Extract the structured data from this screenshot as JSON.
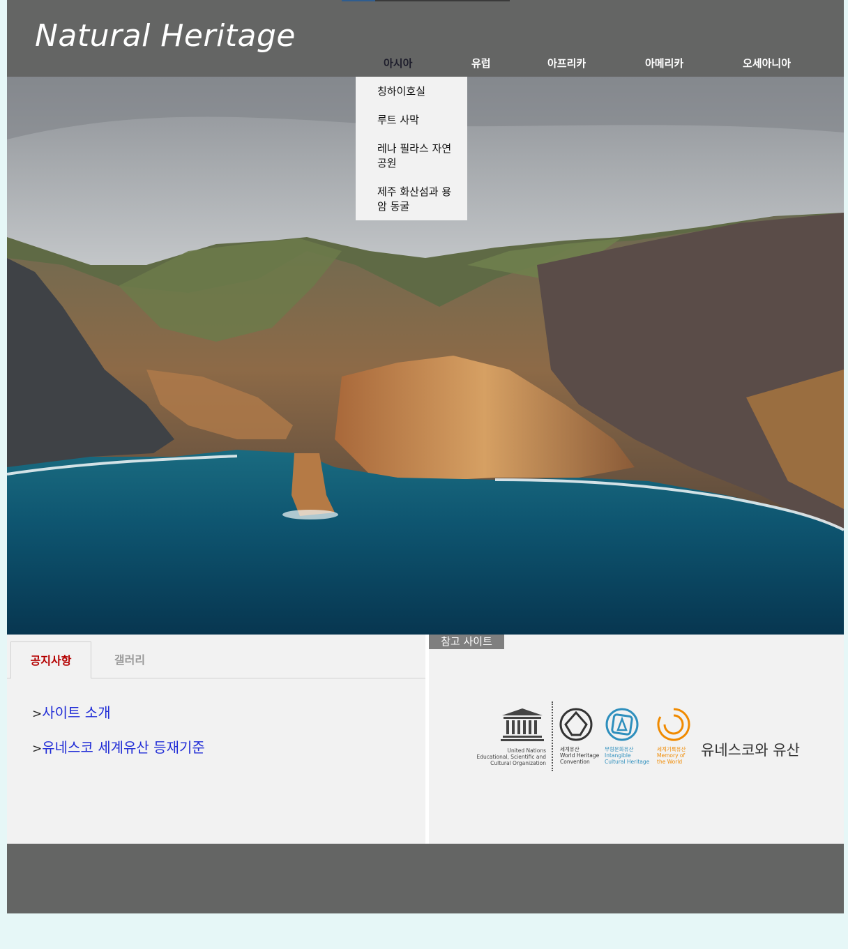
{
  "header": {
    "logo": "Natural Heritage",
    "nav": [
      {
        "label": "아시아",
        "active": true
      },
      {
        "label": "유럽",
        "active": false
      },
      {
        "label": "아프리카",
        "active": false
      },
      {
        "label": "아메리카",
        "active": false
      },
      {
        "label": "오세아니아",
        "active": false
      }
    ]
  },
  "dropdown": {
    "items": [
      "칭하이호실",
      "루트 사막",
      "레나 필라스 자연공원",
      "제주 화산섬과 용암 동굴"
    ]
  },
  "notice": {
    "tabs": [
      "공지사항",
      "갤러리"
    ],
    "links": [
      {
        "arrow": ">",
        "text": "사이트 소개"
      },
      {
        "arrow": ">",
        "text": "유네스코 세계유산 등재기준"
      }
    ]
  },
  "reference": {
    "title": "참고 사이트",
    "banner_title": "유네스코와 유산",
    "logos": [
      {
        "name": "unesco-logo",
        "mark": "UNESCO",
        "caption": [
          "United Nations",
          "Educational, Scientific and",
          "Cultural Organization"
        ],
        "color": "#444444"
      },
      {
        "name": "world-heritage-logo",
        "caption": [
          "세계유산",
          "World Heritage",
          "Convention"
        ],
        "color": "#333333"
      },
      {
        "name": "intangible-heritage-logo",
        "caption": [
          "무형문화유산",
          "Intangible",
          "Cultural Heritage"
        ],
        "color": "#2e8fbd"
      },
      {
        "name": "memory-of-world-logo",
        "caption": [
          "세계기록유산",
          "Memory of",
          "the World"
        ],
        "color": "#f08a00"
      }
    ]
  },
  "colors": {
    "header_bg": "#646564",
    "page_bg": "#e6f7f7",
    "link": "#1f2bd6",
    "active_tab": "#b40000"
  }
}
